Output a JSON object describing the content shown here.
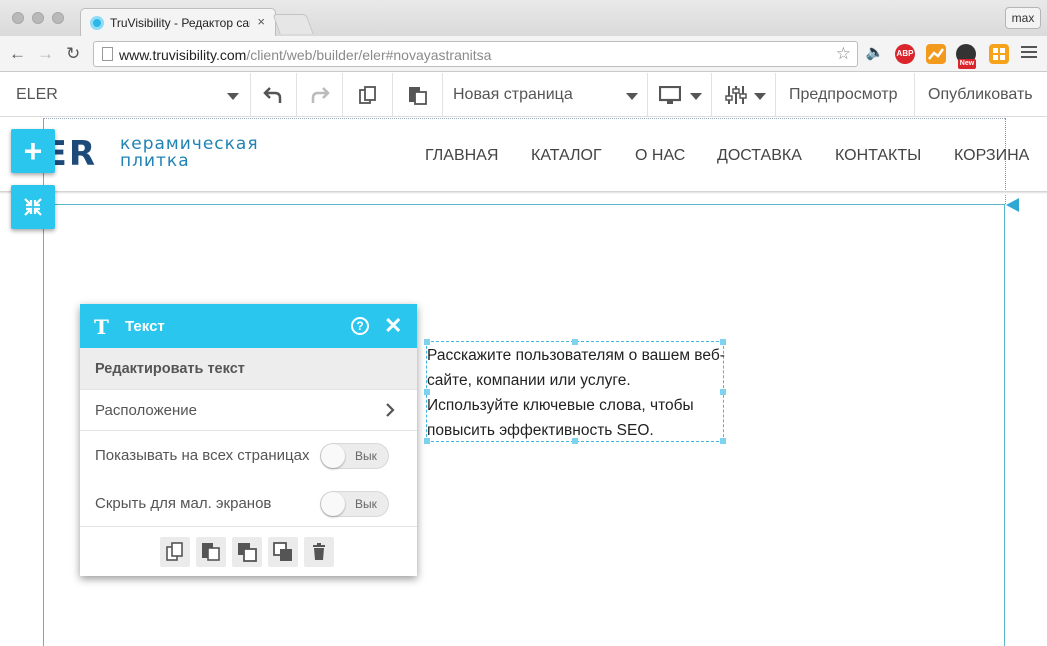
{
  "browser": {
    "tab_title": "TruVisibility - Редактор сайтов",
    "tab_close": "×",
    "user_label": "max",
    "url_host": "www.truvisibility.com",
    "url_path": "/client/web/builder/eler#novayastranitsa",
    "extensions": [
      {
        "name": "abp-icon",
        "label": "ABP",
        "color": "#d9252b"
      },
      {
        "name": "new-badge",
        "label": "New",
        "color": "#d9252b"
      }
    ]
  },
  "builder_toolbar": {
    "site_name": "ELER",
    "page_name": "Новая страница",
    "preview_label": "Предпросмотр",
    "publish_label": "Опубликовать"
  },
  "site": {
    "logo_mark": "ER",
    "logo_line1": "керамическая",
    "logo_line2": "плитка",
    "nav": [
      "ГЛАВНАЯ",
      "КАТАЛОГ",
      "О НАС",
      "ДОСТАВКА",
      "КОНТАКТЫ",
      "КОРЗИНА"
    ]
  },
  "panel": {
    "title": "Текст",
    "help": "?",
    "edit_text": "Редактировать текст",
    "position": "Расположение",
    "show_all_pages": "Показывать на всех страницах",
    "hide_small": "Скрыть для мал. экранов",
    "toggle_off": "Вык",
    "toggles": {
      "show_all_pages": false,
      "hide_small": false
    }
  },
  "text_block": {
    "content": "Расскажите пользователям о вашем веб-сайте, компании или услуге. Используйте ключевые слова, чтобы повысить эффективность SEO."
  },
  "colors": {
    "accent": "#2bc6ee",
    "guide": "#5bb7c9",
    "logo_dark": "#1d4a79",
    "logo_light": "#1f83b4"
  }
}
